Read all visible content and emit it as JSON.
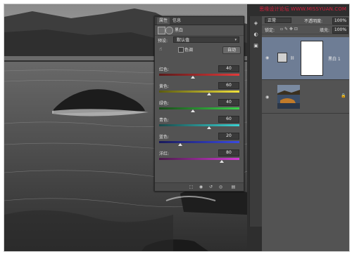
{
  "watermark": "思缘设计论坛 WWW.MISSYUAN.COM",
  "adjustments": {
    "tabs": [
      "属性",
      "信息"
    ],
    "header_title": "黑白",
    "preset_label": "预设:",
    "preset_value": "默认值",
    "tint_label": "色调",
    "auto_button": "自动",
    "sliders": [
      {
        "label": "红色:",
        "value": "40",
        "pos": 0.42,
        "gradient": [
          "#5b1a1a",
          "#e23a3a"
        ]
      },
      {
        "label": "黄色:",
        "value": "60",
        "pos": 0.62,
        "gradient": [
          "#5a5a10",
          "#f2e23a"
        ]
      },
      {
        "label": "绿色:",
        "value": "40",
        "pos": 0.42,
        "gradient": [
          "#1a4a1a",
          "#3ad24a"
        ]
      },
      {
        "label": "青色:",
        "value": "60",
        "pos": 0.62,
        "gradient": [
          "#1a4a4a",
          "#3ad2d2"
        ]
      },
      {
        "label": "蓝色:",
        "value": "20",
        "pos": 0.26,
        "gradient": [
          "#1a1a5a",
          "#3a4ae2"
        ]
      },
      {
        "label": "洋红:",
        "value": "80",
        "pos": 0.78,
        "gradient": [
          "#4a1a4a",
          "#d23ad2"
        ]
      }
    ]
  },
  "layers": {
    "blend_mode": "正常",
    "opacity_label": "不透明度:",
    "opacity_value": "100%",
    "lock_label": "锁定:",
    "fill_label": "填充:",
    "fill_value": "100%",
    "items": [
      {
        "name": "黑白 1",
        "selected": true
      },
      {
        "name": "",
        "selected": false
      }
    ]
  },
  "colors": {
    "panel_bg": "#535353",
    "dark_bg": "#3b3b3b",
    "selected_layer": "#6e7d95",
    "watermark": "#d81e3c"
  }
}
